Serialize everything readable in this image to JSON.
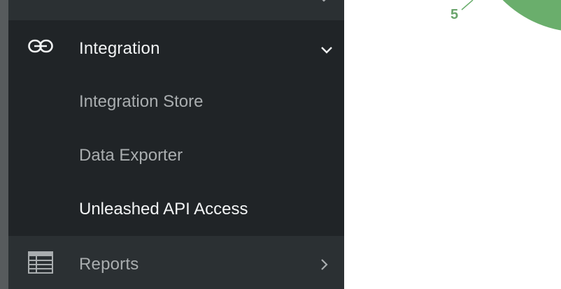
{
  "sidebar": {
    "integration": {
      "label": "Integration",
      "icon": "link-icon",
      "expanded": true,
      "items": [
        {
          "label": "Integration Store",
          "active": false
        },
        {
          "label": "Data Exporter",
          "active": false
        },
        {
          "label": "Unleashed API Access",
          "active": true
        }
      ]
    },
    "reports": {
      "label": "Reports",
      "icon": "table-icon",
      "expanded": false
    }
  },
  "chart": {
    "visible_label": "5",
    "slice_color": "#6aae6c"
  },
  "colors": {
    "sidebar_bg": "#2b3033",
    "sidebar_active_bg": "#202427",
    "text_white": "#f2f4f5",
    "text_grey": "#a9adaf"
  }
}
